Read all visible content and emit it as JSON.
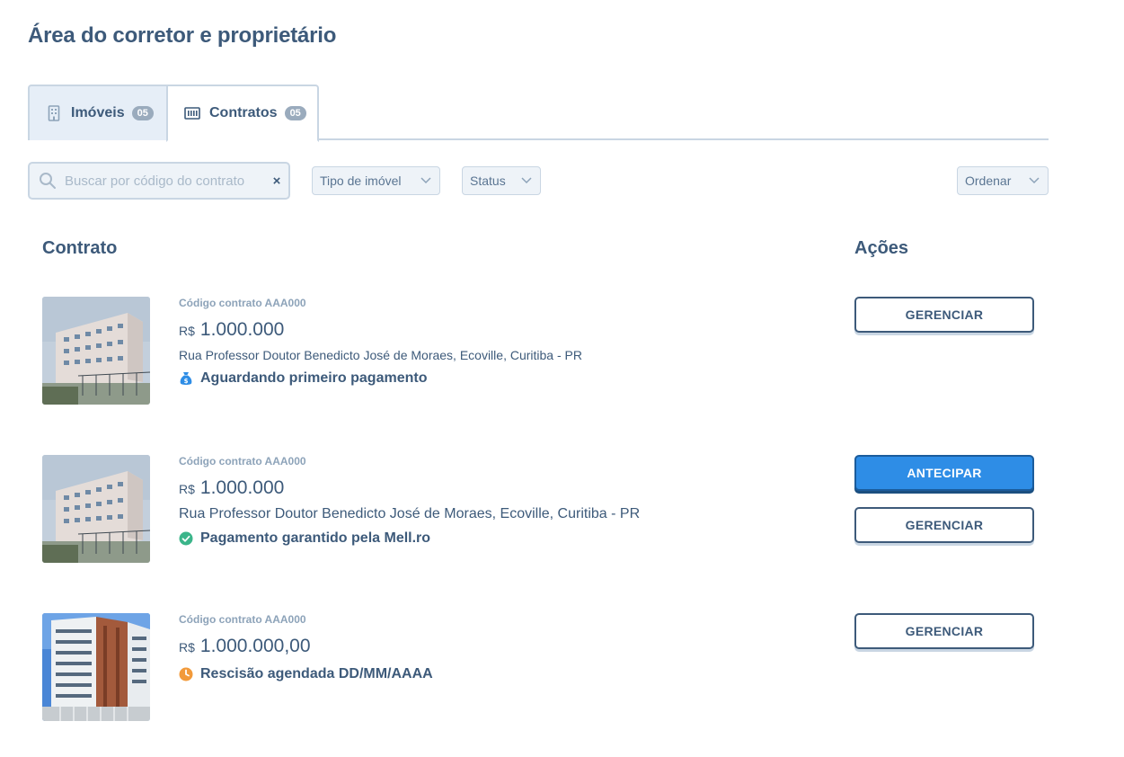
{
  "page": {
    "title": "Área do corretor e proprietário"
  },
  "tabs": [
    {
      "label": "Imóveis",
      "count": "05",
      "icon": "building-icon"
    },
    {
      "label": "Contratos",
      "count": "05",
      "icon": "contract-icon"
    }
  ],
  "filters": {
    "search_placeholder": "Buscar por código do contrato",
    "clear": "×",
    "tipo_imovel": "Tipo de imóvel",
    "status": "Status",
    "ordenar": "Ordenar"
  },
  "columns": {
    "contrato": "Contrato",
    "acoes": "Ações"
  },
  "contracts": [
    {
      "code": "Código contrato AAA000",
      "currency": "R$",
      "value": "1.000.000",
      "address": "Rua Professor Doutor Benedicto José de Moraes, Ecoville, Curitiba - PR",
      "status": "Aguardando primeiro pagamento",
      "status_icon": "money-bag-icon",
      "status_color": "#2e8de6",
      "actions": [
        "GERENCIAR"
      ]
    },
    {
      "code": "Código contrato AAA000",
      "currency": "R$",
      "value": "1.000.000",
      "address": "Rua Professor Doutor Benedicto José de Moraes, Ecoville, Curitiba - PR",
      "status": "Pagamento garantido pela Mell.ro",
      "status_icon": "check-circle-icon",
      "status_color": "#3bb58a",
      "actions": [
        "ANTECIPAR",
        "GERENCIAR"
      ]
    },
    {
      "code": "Código contrato AAA000",
      "currency": "R$",
      "value": "1.000.000,00",
      "address": "",
      "status": "Rescisão agendada DD/MM/AAAA",
      "status_icon": "clock-icon",
      "status_color": "#f29a3a",
      "actions": [
        "GERENCIAR"
      ]
    }
  ],
  "colors": {
    "primary": "#2e8de6",
    "text": "#3d5a7a",
    "border": "#c9d6e3"
  }
}
